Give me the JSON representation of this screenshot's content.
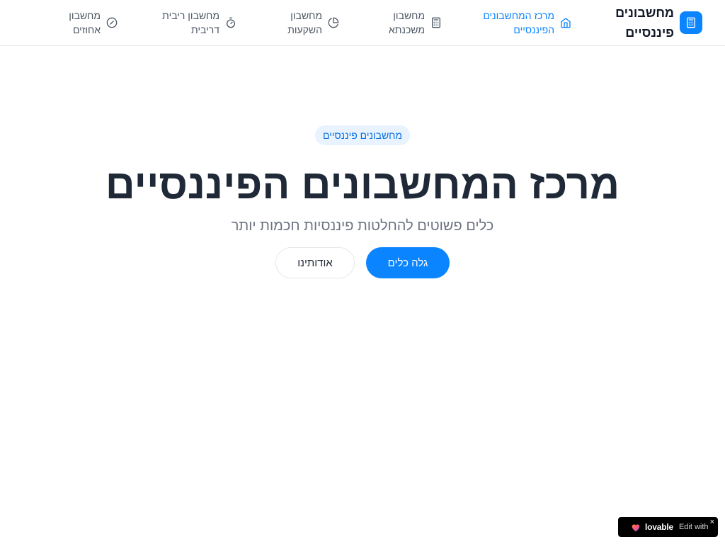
{
  "brand": {
    "name": "מחשבונים פיננסיים",
    "icon": "calculator-icon",
    "accent_color": "#0a84ff"
  },
  "nav": {
    "items": [
      {
        "label": "מרכז המחשבונים הפיננסיים",
        "icon": "home-icon",
        "active": true
      },
      {
        "label": "מחשבון משכנתא",
        "icon": "calculator-icon",
        "active": false
      },
      {
        "label": "מחשבון השקעות",
        "icon": "pie-chart-icon",
        "active": false
      },
      {
        "label": "מחשבון ריבית דריבית",
        "icon": "timer-icon",
        "active": false
      },
      {
        "label": "מחשבון אחוזים",
        "icon": "percent-icon",
        "active": false
      }
    ]
  },
  "hero": {
    "badge": "מחשבונים פיננסיים",
    "title": "מרכז המחשבונים הפיננסיים",
    "subtitle": "כלים פשוטים להחלטות פיננסיות חכמות יותר",
    "primary_button": "גלה כלים",
    "secondary_button": "אודותינו"
  },
  "lovable_badge": {
    "edit_label": "Edit with",
    "brand": "lovable",
    "close": "×"
  }
}
